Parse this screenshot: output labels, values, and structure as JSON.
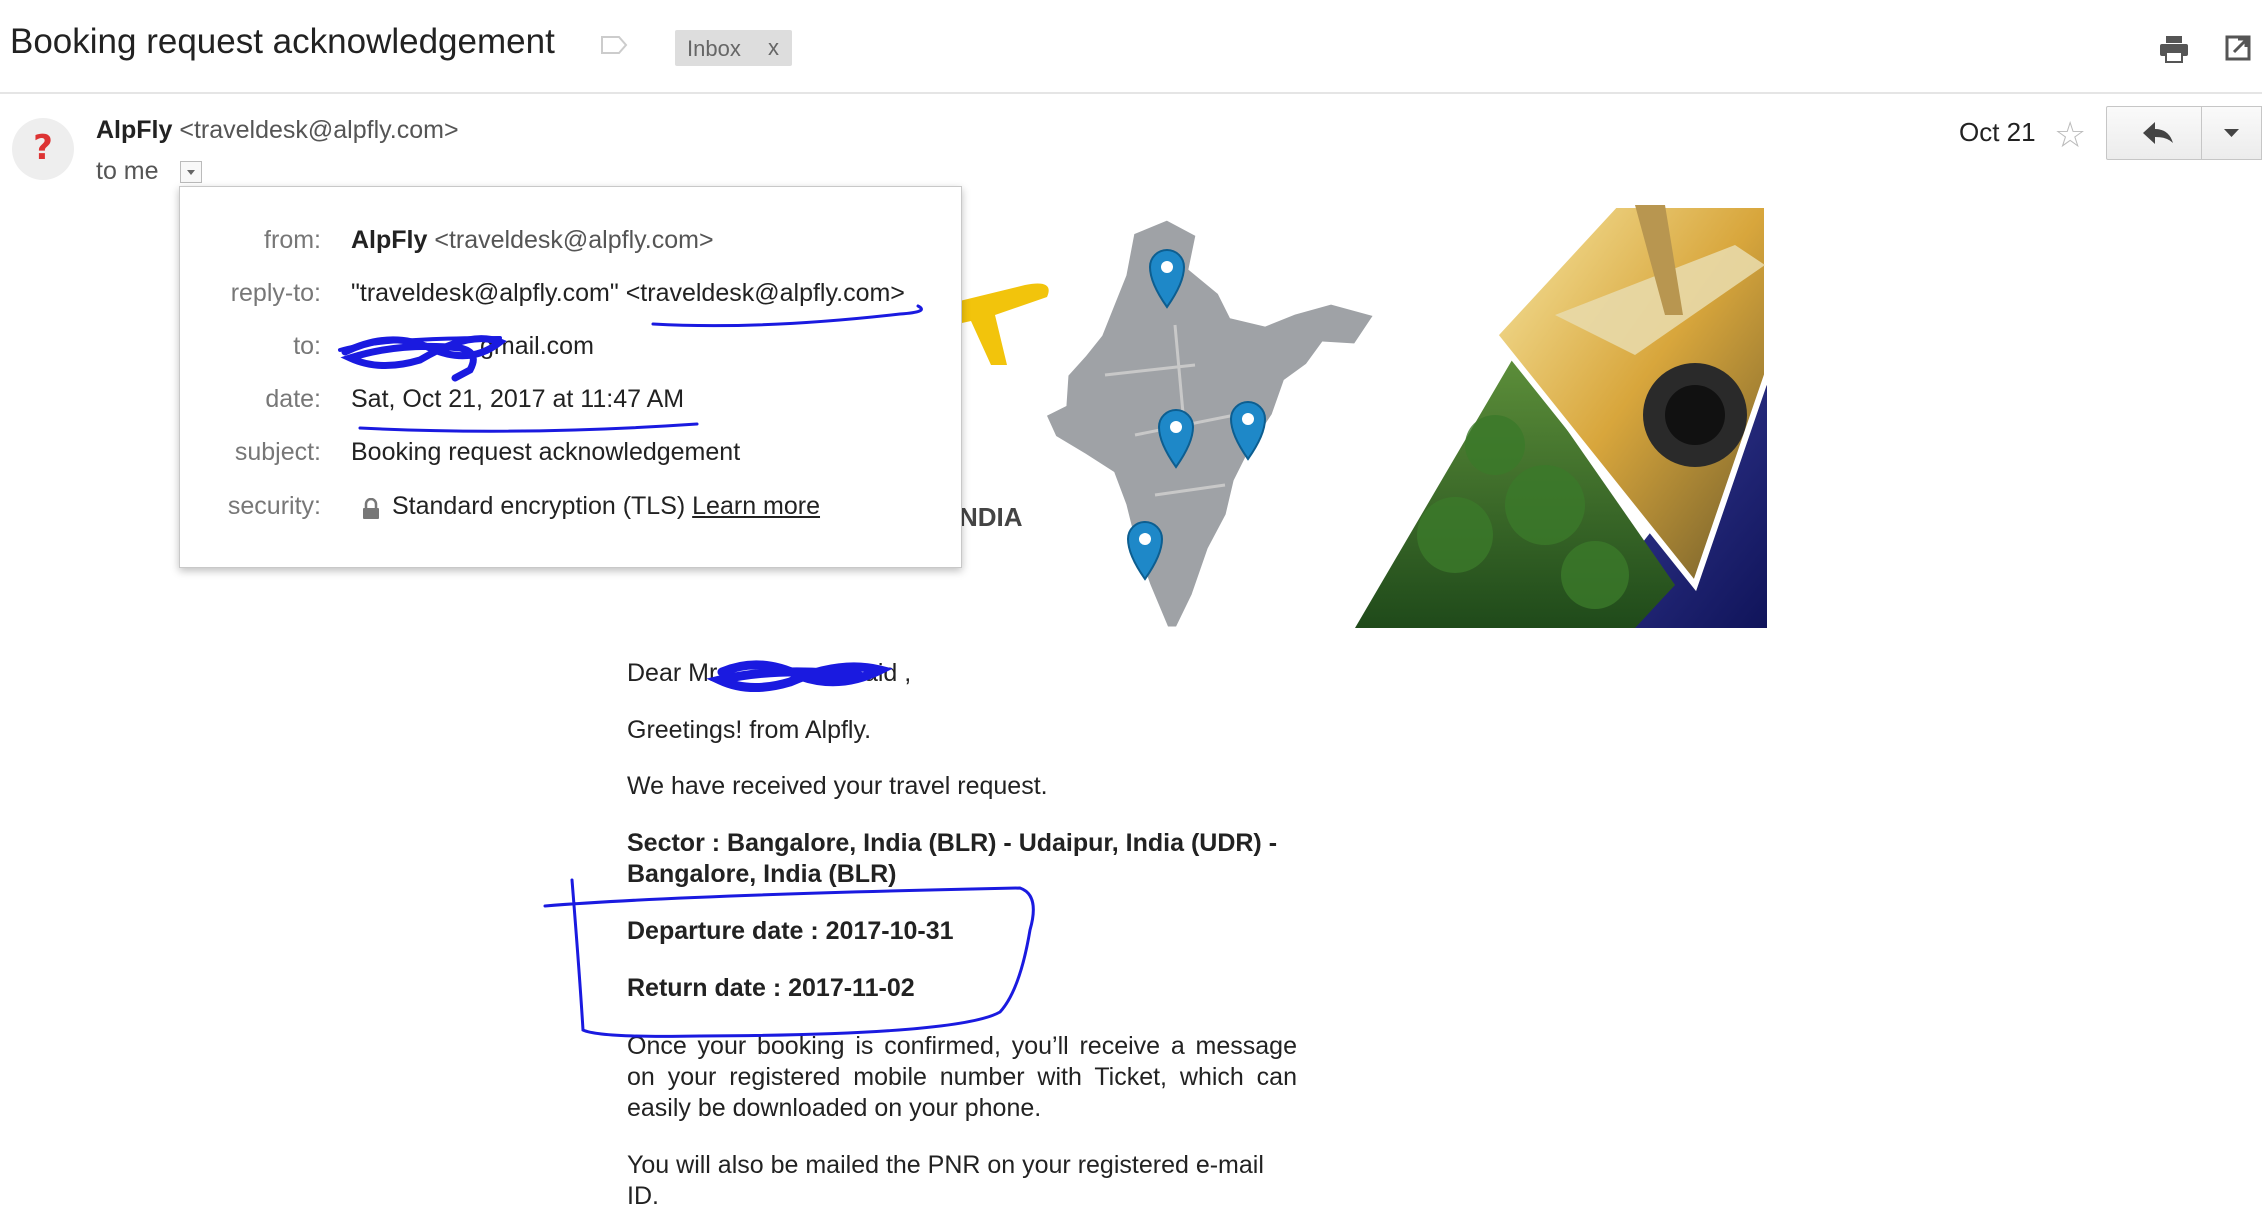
{
  "header": {
    "subject": "Booking request acknowledgement",
    "label_chip": "Inbox",
    "label_chip_close": "x",
    "icons": [
      "label-tag-icon",
      "print-icon",
      "popout-icon"
    ]
  },
  "message": {
    "sender_name": "AlpFly",
    "sender_email": "<traveldesk@alpfly.com>",
    "to_line": "to me",
    "date_short": "Oct 21",
    "avatar_glyph": "?"
  },
  "details": {
    "from_label": "from:",
    "from_name": "AlpFly",
    "from_email": "<traveldesk@alpfly.com>",
    "reply_to_label": "reply-to:",
    "reply_to_value": "\"traveldesk@alpfly.com\" <traveldesk@alpfly.com>",
    "to_label": "to:",
    "to_value": "gmail.com",
    "date_label": "date:",
    "date_value": "Sat, Oct 21, 2017 at 11:47 AM",
    "subject_label": "subject:",
    "subject_value": "Booking request acknowledgement",
    "security_label": "security:",
    "security_value": "Standard encryption (TLS)",
    "learn_more": "Learn more"
  },
  "banner": {
    "partial_text": "NDIA"
  },
  "body": {
    "greeting_prefix": "Dear Mr",
    "greeting_suffix": "Baid ,",
    "greetings": "Greetings! from Alpfly.",
    "received": "We have received your travel request.",
    "sector": "Sector : Bangalore, India (BLR) - Udaipur, India (UDR) -Bangalore, India (BLR)",
    "departure": "Departure date : 2017-10-31",
    "return": "Return date : 2017-11-02",
    "confirm_note": "Once your booking is confirmed, you’ll receive a message on your registered mobile number with Ticket, which can easily be downloaded on your phone.",
    "pnr_note": "You will also be mailed the PNR on your registered e-mail ID."
  },
  "colors": {
    "annotation_ink": "#1a1ae0",
    "pin_blue": "#1e88c8",
    "plane_yellow": "#f2c40c"
  }
}
